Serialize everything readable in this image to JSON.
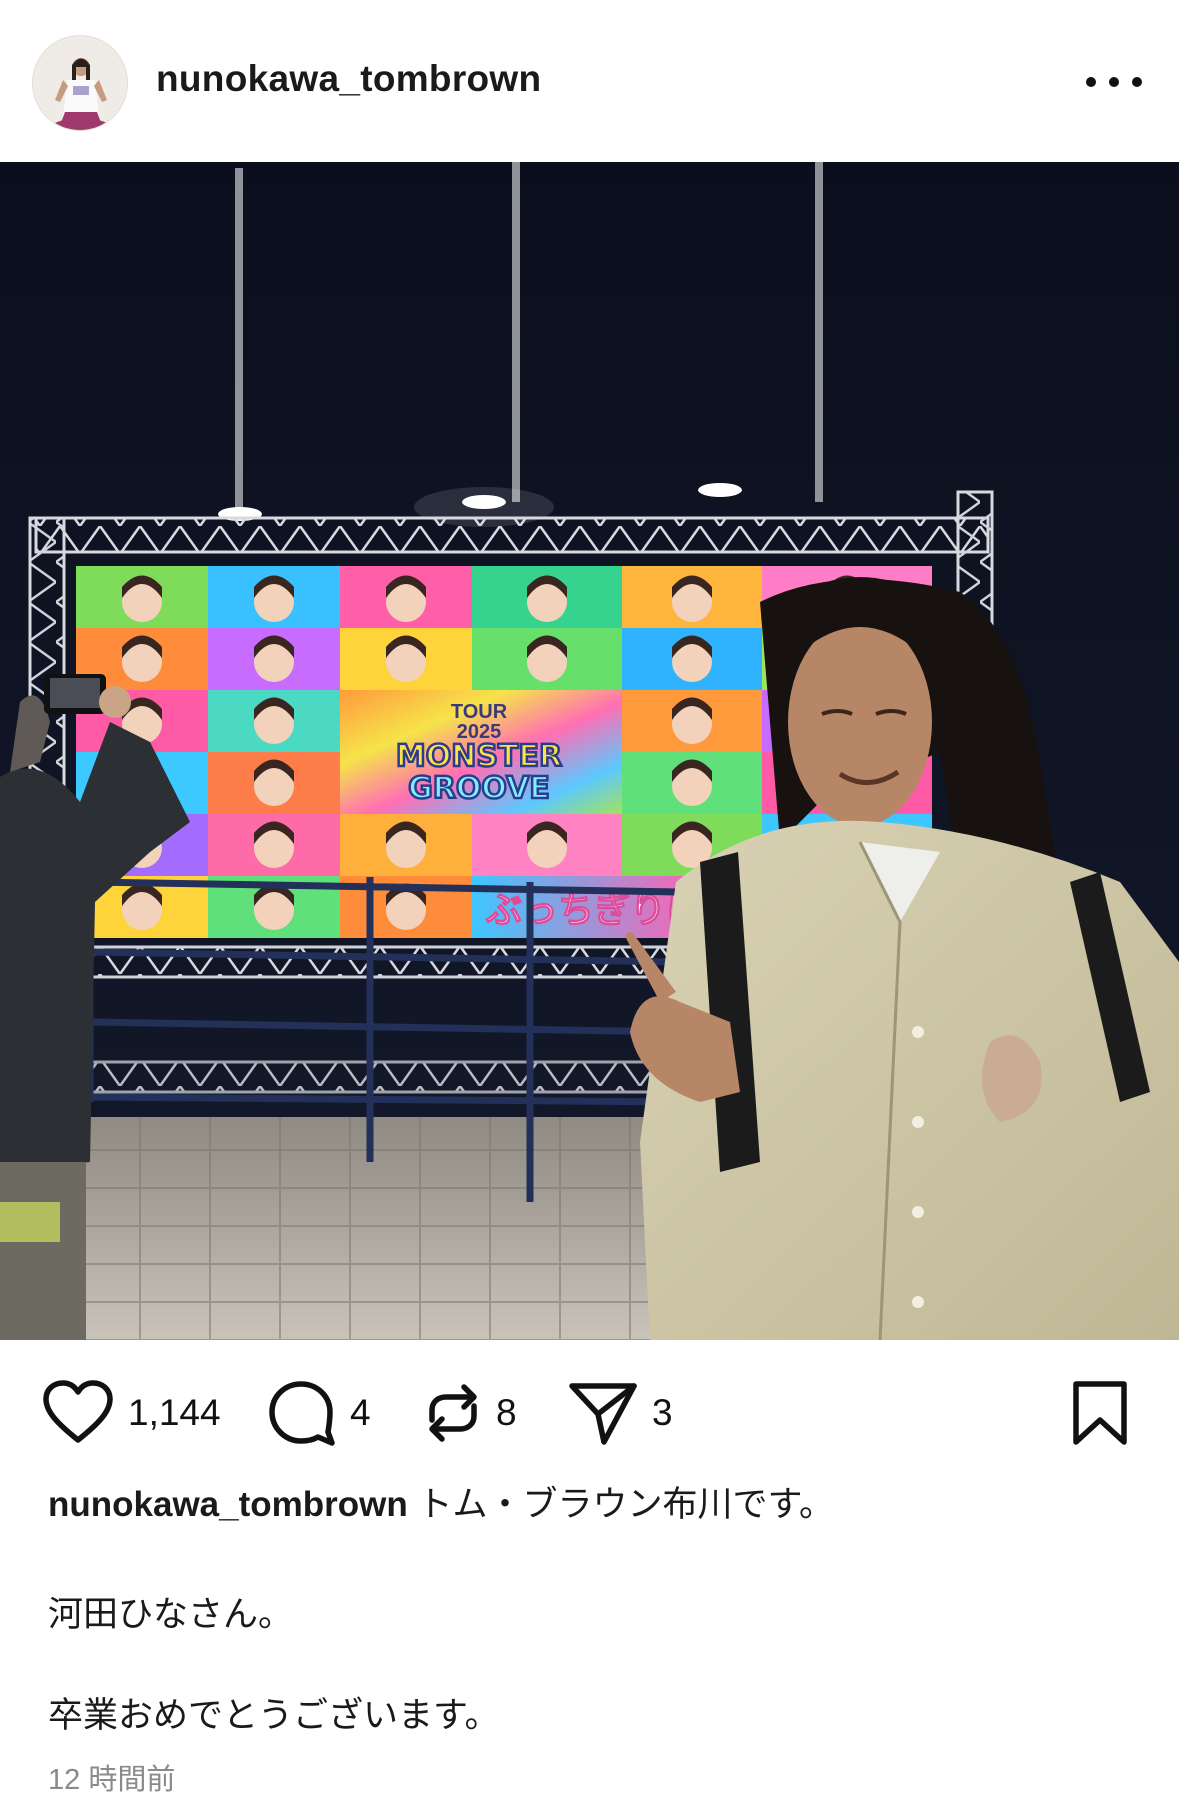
{
  "post": {
    "username": "nunokawa_tombrown",
    "more_icon": "more-horizontal-icon",
    "actions": {
      "like_count": "1,144",
      "comment_count": "4",
      "repost_count": "8",
      "share_count": "3"
    },
    "caption": {
      "username": "nunokawa_tombrown",
      "line1": "トム・ブラウン布川です。",
      "line2": "河田ひなさん。",
      "line3": "卒業おめでとうございます。"
    },
    "timestamp": "12 時間前"
  },
  "photo": {
    "billboard_text": {
      "tour": "TOUR",
      "year": "2025",
      "title_top": "MONSTER",
      "title_bottom": "GROOVE",
      "slogan": "ぶっちぎりに、笑"
    }
  },
  "colors": {
    "text": "#111111",
    "muted": "#8a8a8a",
    "background": "#ffffff"
  }
}
